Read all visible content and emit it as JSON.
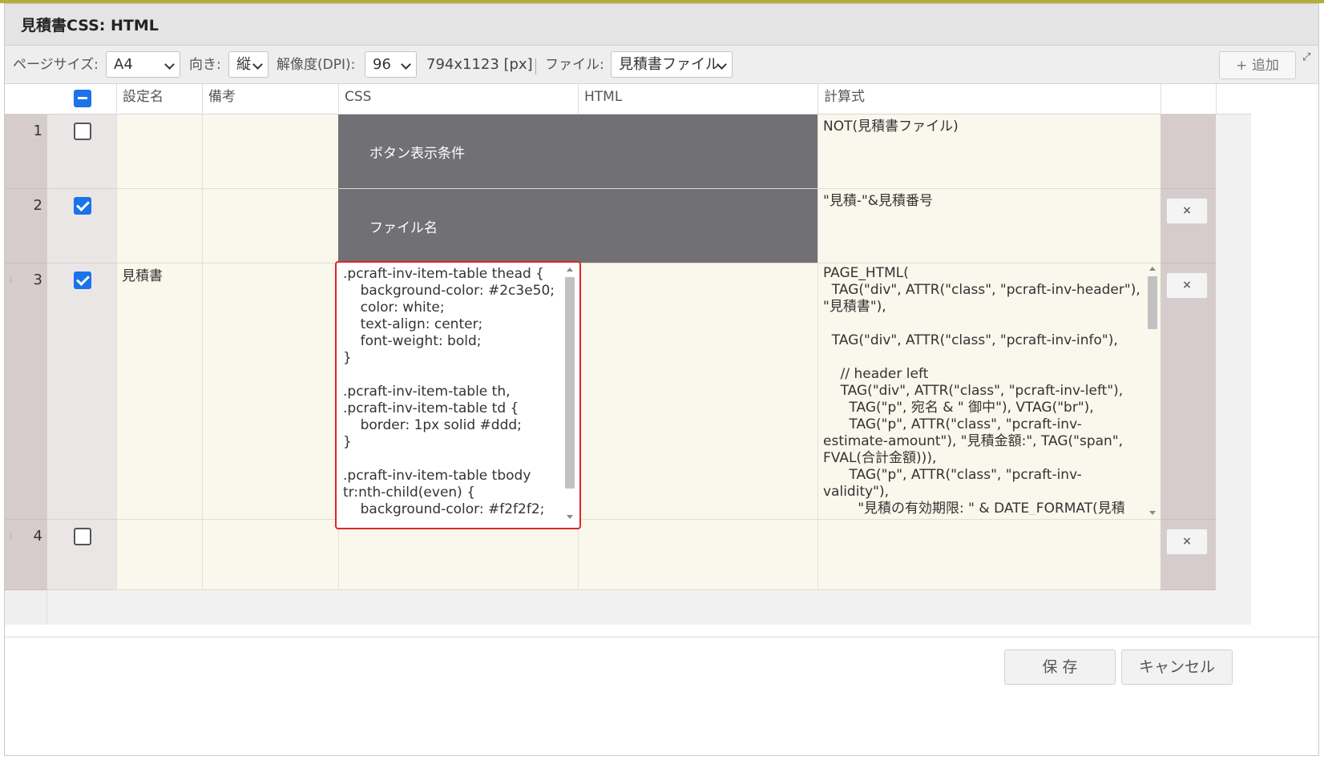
{
  "dialog": {
    "title": "見積書CSS: HTML"
  },
  "toolbar": {
    "page_size_label": "ページサイズ:",
    "page_size_value": "A4",
    "orientation_label": "向き:",
    "orientation_value": "縦",
    "dpi_label": "解像度(DPI):",
    "dpi_value": "96",
    "size_readout": "794x1123 [px]",
    "file_label": "ファイル:",
    "file_value": "見積書ファイル",
    "add_label": "+ 追加"
  },
  "table": {
    "columns": [
      "設定名",
      "備考",
      "CSS",
      "HTML",
      "計算式"
    ],
    "rows": [
      {
        "num": "1",
        "checked": false,
        "name": "",
        "note": "",
        "merged_label": "ボタン表示条件",
        "formula": "NOT(見積書ファイル)"
      },
      {
        "num": "2",
        "checked": true,
        "name": "",
        "note": "",
        "merged_label": "ファイル名",
        "formula": "\"見積-\"&見積番号"
      },
      {
        "num": "3",
        "checked": true,
        "name": "見積書",
        "note": "",
        "css": ".pcraft-inv-item-table thead {\n    background-color: #2c3e50;\n    color: white;\n    text-align: center;\n    font-weight: bold;\n}\n\n.pcraft-inv-item-table th,\n.pcraft-inv-item-table td {\n    border: 1px solid #ddd;\n}\n\n.pcraft-inv-item-table tbody\ntr:nth-child(even) {\n    background-color: #f2f2f2;",
        "html": "",
        "formula": "PAGE_HTML(\n  TAG(\"div\", ATTR(\"class\", \"pcraft-inv-header\"),\n\"見積書\"),\n\n  TAG(\"div\", ATTR(\"class\", \"pcraft-inv-info\"),\n\n    // header left\n    TAG(\"div\", ATTR(\"class\", \"pcraft-inv-left\"),\n      TAG(\"p\", 宛名 & \" 御中\"), VTAG(\"br\"),\n      TAG(\"p\", ATTR(\"class\", \"pcraft-inv-\nestimate-amount\"), \"見積金額:\", TAG(\"span\",\nFVAL(合計金額))),\n      TAG(\"p\", ATTR(\"class\", \"pcraft-inv-\nvalidity\"),\n        \"見積の有効期限: \" & DATE_FORMAT(見積"
      },
      {
        "num": "4",
        "checked": false,
        "name": "",
        "note": "",
        "formula": ""
      }
    ],
    "delete_icon": "×"
  },
  "footer": {
    "save_label": "保 存",
    "cancel_label": "キャンセル"
  },
  "colors": {
    "accent": "#1a73e8",
    "highlight": "#e0252b",
    "dark_cell": "#707075",
    "row_bg": "#faf7ec"
  }
}
